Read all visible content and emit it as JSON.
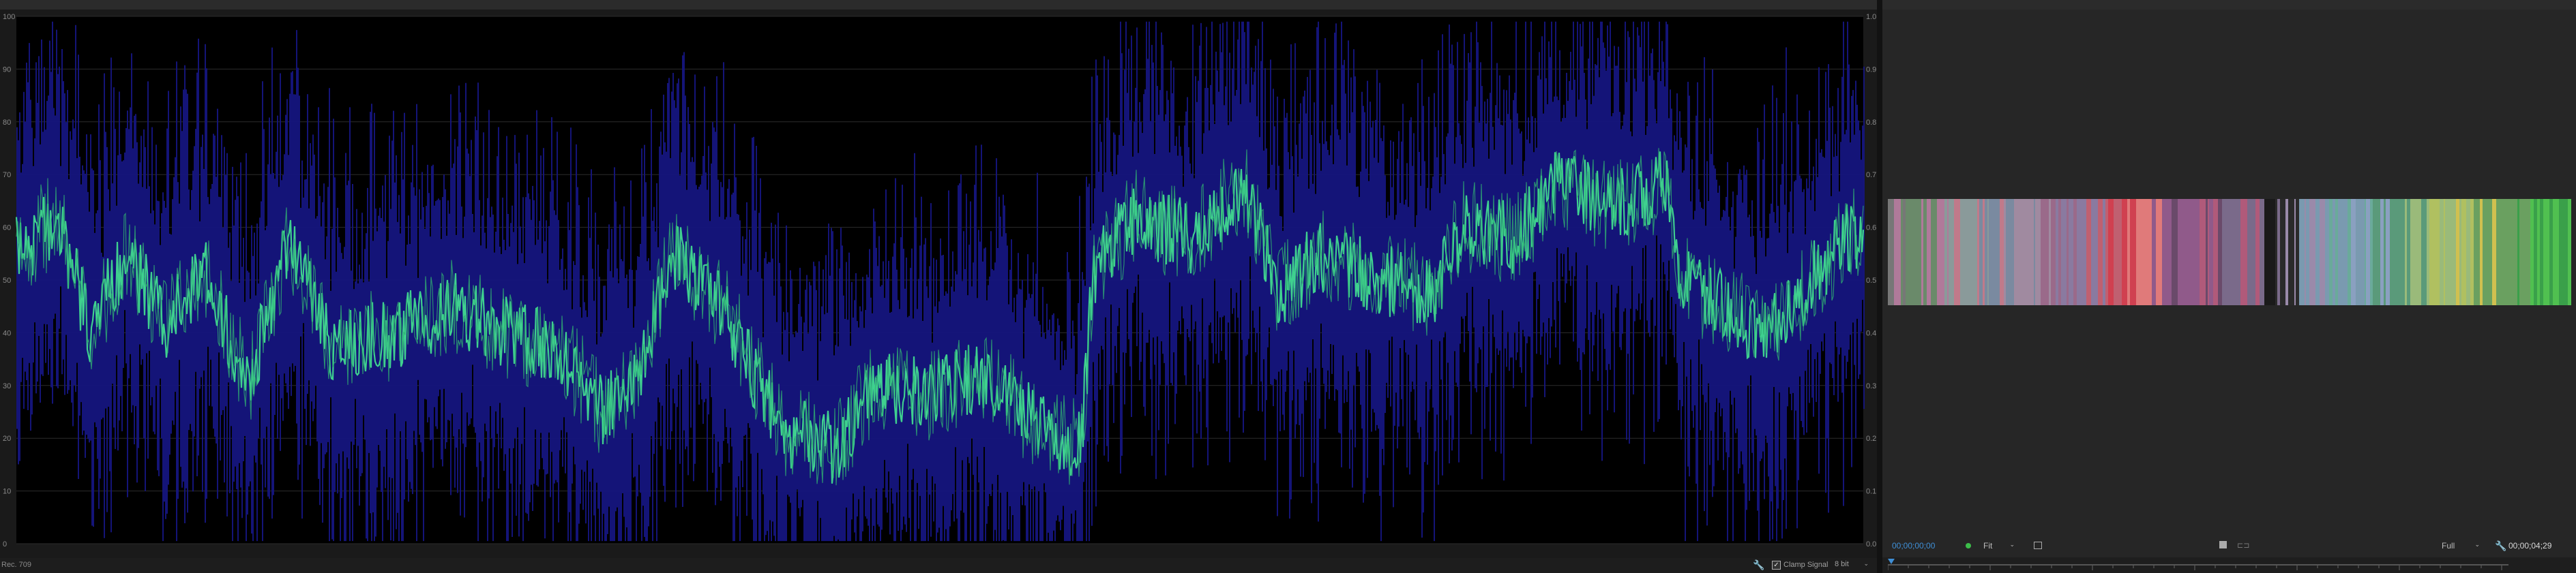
{
  "scope": {
    "left_axis_labels": [
      "0",
      "10",
      "20",
      "30",
      "40",
      "50",
      "60",
      "70",
      "80",
      "90",
      "100"
    ],
    "right_axis_labels": [
      "0.0",
      "0.1",
      "0.2",
      "0.3",
      "0.4",
      "0.5",
      "0.6",
      "0.7",
      "0.8",
      "0.9",
      "1.0"
    ],
    "rec_label": "Rec. 709",
    "clamp_label": "Clamp Signal",
    "clamp_checked": true,
    "level_select": "8 bit",
    "colors": {
      "luma": "#3fd08f",
      "chroma": "#15157e",
      "background": "#000000"
    }
  },
  "monitor": {
    "timecode_current": "00;00;00;00",
    "fit_select": "Fit",
    "resolution_select": "Full",
    "timecode_total": "00;00;04;29"
  },
  "icons": [
    "wrench-icon",
    "checkbox-icon",
    "settings-icon",
    "grid-icon",
    "safe-margin-icon",
    "wrench-icon",
    "playhead-icon"
  ]
}
